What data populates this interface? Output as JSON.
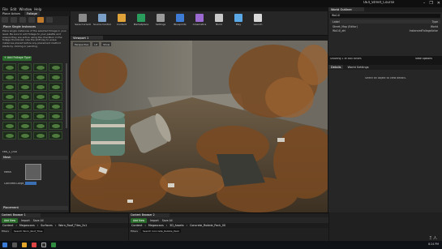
{
  "window": {
    "project_title": "UE4_Street_Course",
    "menus": [
      "File",
      "Edit",
      "Window",
      "Help"
    ],
    "controls": [
      "–",
      "❐",
      "✕"
    ]
  },
  "modes": {
    "tabs": [
      "Place Actors",
      "Foliage"
    ],
    "active_mode_index": 4,
    "paint_title": "Place Single Instances",
    "paint_help": "Place single instances of the selected foliage in your level. Be sure to add foliage to your palette and ensure they are active using the checkbox in the foliage thumbnail. Use the shift key to erase instances placed before any placement method starts by clicking or painting.",
    "add_foliage_label": "+ Add Foliage Type ▾",
    "foliage_count": 32,
    "selected_label": "Fan_1_000",
    "mesh_header": "Mesh",
    "mesh_label": "Mesh",
    "mesh_value": "Concrete.Large_Grass",
    "placement_header": "Placement"
  },
  "toolbar": {
    "buttons": [
      "Save Current",
      "Source Control",
      "Content",
      "Marketplace",
      "Settings",
      "Blueprints",
      "Cinematics",
      "Build",
      "Play",
      "Launch"
    ]
  },
  "viewport": {
    "tab_label": "Viewport 1",
    "overlay": [
      "Perspective",
      "Lit",
      "Show"
    ],
    "mode_tools": [
      "Select",
      "Single",
      "Lasso",
      "Fill",
      "Erase",
      "Remove",
      "Move"
    ],
    "tool_labels": [
      "Paint",
      "Reapply",
      "Select",
      "All",
      "Deselect",
      "Select Invalid",
      "Lasso",
      "Fill"
    ]
  },
  "outliner": {
    "tab_label": "World Outliner",
    "search_value": "Wo14l",
    "col_label": "Label",
    "col_type": "Type",
    "rows": [
      {
        "label": "Street_Map (Editor)",
        "type": "World"
      },
      {
        "label": "Wo14l_ahl",
        "type": "InstancedFoliageActor"
      }
    ],
    "count": "Showing 1 of 884 actors",
    "view_options": "View Options"
  },
  "details": {
    "tabs": [
      "Details",
      "World Settings"
    ],
    "empty_text": "Select an object to view details."
  },
  "content_browsers": [
    {
      "tab": "Content Browser 1",
      "add_new": "Add New",
      "import": "Import",
      "save_all": "Save All",
      "path": [
        "Content",
        "Megascans",
        "Surfaces",
        "Worn_Roof_Tiles_2s1"
      ],
      "filters": "Filters",
      "search_placeholder": "Search Worn_Roof_Tiles"
    },
    {
      "tab": "Content Browser 2",
      "add_new": "Add New",
      "import": "Import",
      "save_all": "Save All",
      "path": [
        "Content",
        "Megascans",
        "3D_Assets",
        "Concrete_Rubble_Pack_00"
      ],
      "filters": "Filters",
      "search_placeholder": "Search Concrete_Rubble_Pack"
    }
  ],
  "taskbar": {
    "time": "8:24 PM",
    "watermark": "Ξ 人"
  }
}
